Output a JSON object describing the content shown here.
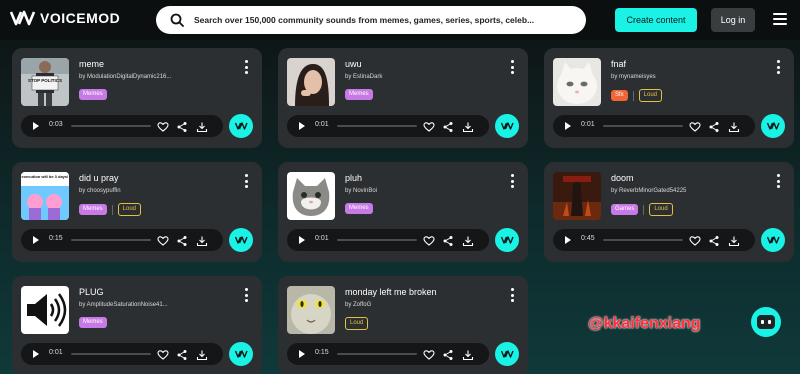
{
  "header": {
    "logo_text": "VOICEMOD",
    "search_placeholder": "Search over 150,000 community sounds from memes, games, series, sports, celeb...",
    "create_label": "Create content",
    "login_label": "Log in"
  },
  "sounds": [
    {
      "title": "meme",
      "author": "by ModulationDigitalDynamic216...",
      "time": "0:03",
      "tags": [
        {
          "label": "Memes",
          "kind": "memes"
        }
      ],
      "thumb": "protest-sign-image"
    },
    {
      "title": "uwu",
      "author": "by EstinaDark",
      "time": "0:01",
      "tags": [
        {
          "label": "Memes",
          "kind": "memes"
        }
      ],
      "thumb": "girl-photo-image"
    },
    {
      "title": "fnaf",
      "author": "by mynameisyes",
      "time": "0:01",
      "tags": [
        {
          "label": "Sfx",
          "kind": "sfx"
        },
        {
          "label": "Loud",
          "kind": "loud"
        }
      ],
      "thumb": "white-cat-image"
    },
    {
      "title": "did u pray",
      "author": "by choosypuffin",
      "time": "0:15",
      "tags": [
        {
          "label": "Memes",
          "kind": "memes"
        },
        {
          "label": "Loud",
          "kind": "loud"
        }
      ],
      "thumb": "cartoon-meme-image"
    },
    {
      "title": "pluh",
      "author": "by NovinBoi",
      "time": "0:01",
      "tags": [
        {
          "label": "Memes",
          "kind": "memes"
        }
      ],
      "thumb": "cat-image"
    },
    {
      "title": "doom",
      "author": "by ReverbMinorGated54225",
      "time": "0:45",
      "tags": [
        {
          "label": "Games",
          "kind": "games"
        },
        {
          "label": "Loud",
          "kind": "loud"
        }
      ],
      "thumb": "doom-cover-image"
    },
    {
      "title": "PLUG",
      "author": "by AmplitudeSaturationNoise41...",
      "time": "0:01",
      "tags": [
        {
          "label": "Memes",
          "kind": "memes"
        }
      ],
      "thumb": "speaker-icon-image"
    },
    {
      "title": "monday left me broken",
      "author": "by ZoffoG",
      "time": "0:15",
      "tags": [
        {
          "label": "Loud",
          "kind": "loud"
        }
      ],
      "thumb": "glowing-eyes-cat-image"
    }
  ],
  "thumb_text": {
    "meme_sign": "STOP POLITICS",
    "pray_caption": "execution will be 3 days!"
  },
  "watermark": "@kkaifenxiang",
  "colors": {
    "accent": "#19f2e4",
    "memes": "#c77ae5",
    "sfx": "#f06735",
    "loud": "#e3c040",
    "card": "#2c2f32"
  }
}
